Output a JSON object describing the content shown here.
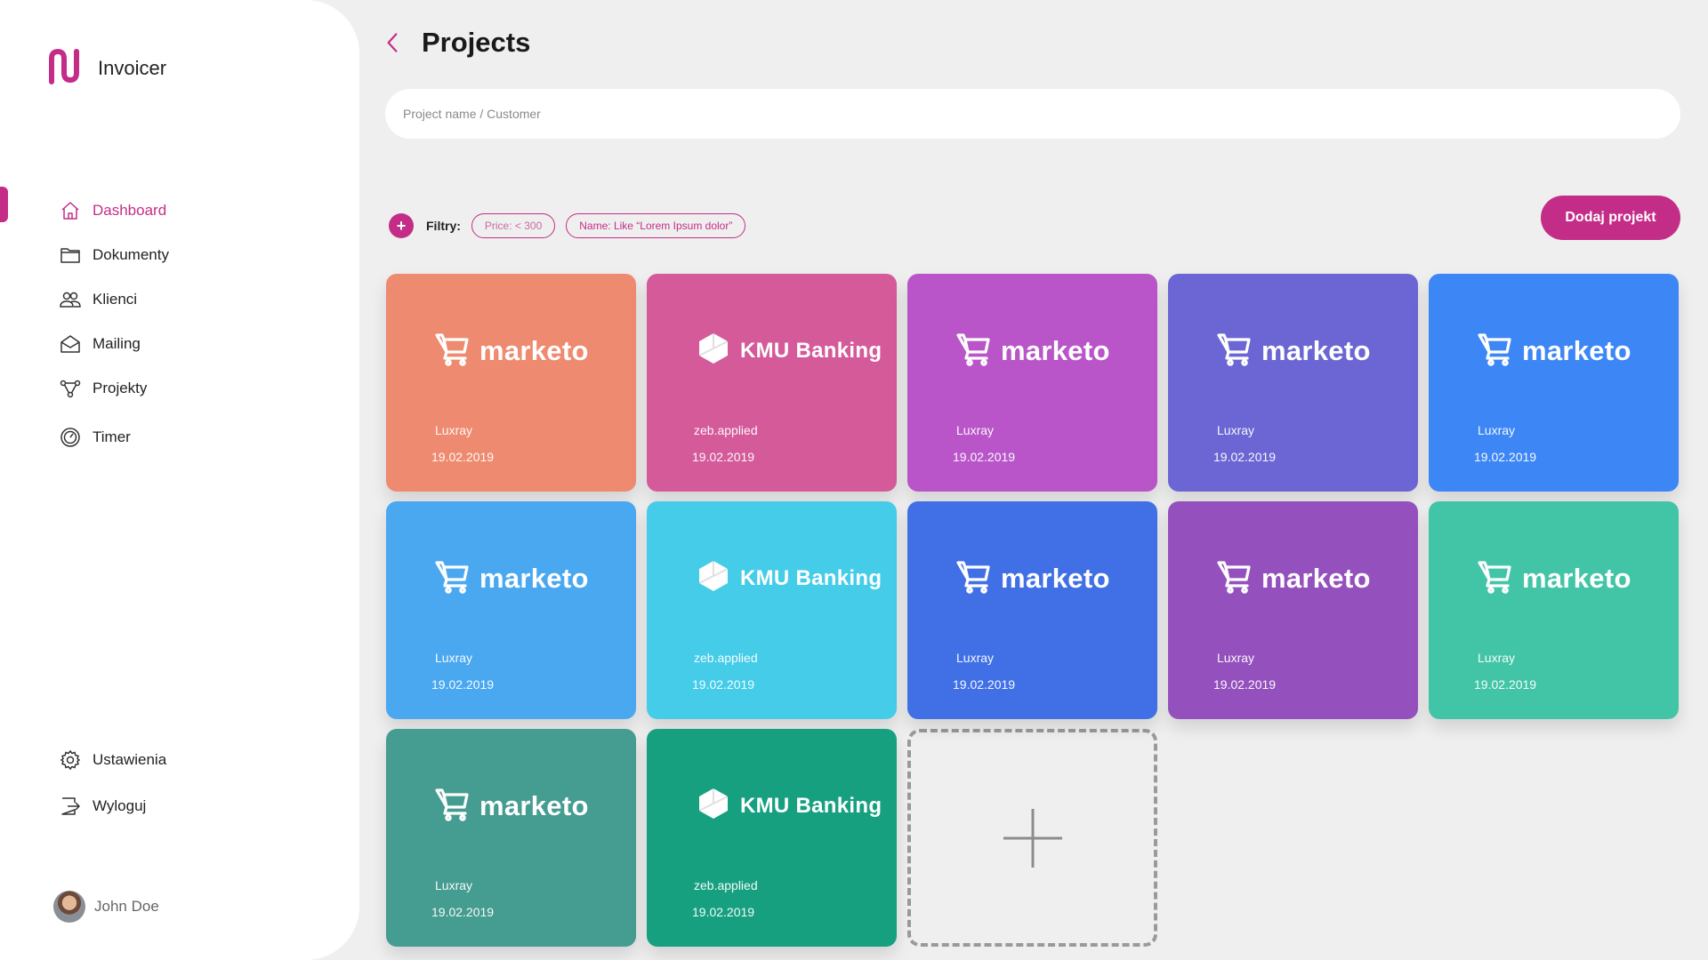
{
  "app": {
    "name": "Invoicer"
  },
  "sidebar": {
    "items": [
      {
        "label": "Dashboard",
        "icon": "home-icon",
        "active": true
      },
      {
        "label": "Dokumenty",
        "icon": "folder-icon"
      },
      {
        "label": "Klienci",
        "icon": "users-icon"
      },
      {
        "label": "Mailing",
        "icon": "mail-icon"
      },
      {
        "label": "Projekty",
        "icon": "share-icon"
      },
      {
        "label": "Timer",
        "icon": "timer-icon"
      }
    ],
    "bottom_items": [
      {
        "label": "Ustawienia",
        "icon": "gear-icon"
      },
      {
        "label": "Wyloguj",
        "icon": "logout-icon"
      }
    ],
    "user": {
      "name": "John Doe"
    }
  },
  "header": {
    "title": "Projects"
  },
  "search": {
    "placeholder": "Project name / Customer",
    "value": ""
  },
  "filters": {
    "label": "Filtry:",
    "chips": [
      "Price: < 300",
      "Name: Like “Lorem Ipsum dolor”"
    ]
  },
  "actions": {
    "add_project": "Dodaj projekt"
  },
  "accent_color": "#c42d87",
  "projects": [
    {
      "brand": "marketo",
      "client": "Luxray",
      "date": "19.02.2019",
      "color": "#ee8a6f"
    },
    {
      "brand": "KMU Banking",
      "client": "zeb.applied",
      "date": "19.02.2019",
      "color": "#d45a9a"
    },
    {
      "brand": "marketo",
      "client": "Luxray",
      "date": "19.02.2019",
      "color": "#b955c9"
    },
    {
      "brand": "marketo",
      "client": "Luxray",
      "date": "19.02.2019",
      "color": "#6b66d3"
    },
    {
      "brand": "marketo",
      "client": "Luxray",
      "date": "19.02.2019",
      "color": "#3d86f5"
    },
    {
      "brand": "marketo",
      "client": "Luxray",
      "date": "19.02.2019",
      "color": "#4aa8f1"
    },
    {
      "brand": "KMU Banking",
      "client": "zeb.applied",
      "date": "19.02.2019",
      "color": "#44cce8"
    },
    {
      "brand": "marketo",
      "client": "Luxray",
      "date": "19.02.2019",
      "color": "#4170e6"
    },
    {
      "brand": "marketo",
      "client": "Luxray",
      "date": "19.02.2019",
      "color": "#9451bd"
    },
    {
      "brand": "marketo",
      "client": "Luxray",
      "date": "19.02.2019",
      "color": "#42c5a6"
    },
    {
      "brand": "marketo",
      "client": "Luxray",
      "date": "19.02.2019",
      "color": "#459c90"
    },
    {
      "brand": "KMU Banking",
      "client": "zeb.applied",
      "date": "19.02.2019",
      "color": "#17a080"
    }
  ]
}
